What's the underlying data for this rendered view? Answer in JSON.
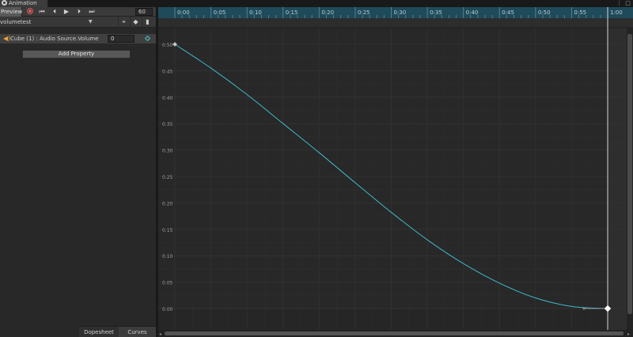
{
  "window": {
    "tab_title": "Animation"
  },
  "toolbar": {
    "preview_label": "Preview",
    "frame_value": "60",
    "buttons": [
      "first-key",
      "prev-key",
      "play",
      "next-key",
      "last-key"
    ]
  },
  "clip": {
    "name": "volumetest"
  },
  "property": {
    "label": "Cube (1) : Audio Source.Volume",
    "value": "0"
  },
  "add_property_label": "Add Property",
  "bottom_tabs": {
    "dopesheet": "Dopesheet",
    "curves": "Curves"
  },
  "chart_data": {
    "type": "line",
    "x_ticks": [
      "0:00",
      "0:05",
      "0:10",
      "0:15",
      "0:20",
      "0:25",
      "0:30",
      "0:35",
      "0:40",
      "0:45",
      "0:50",
      "0:55",
      "1:00"
    ],
    "y_ticks": [
      "0.50",
      "0.45",
      "0.40",
      "0.35",
      "0.30",
      "0.25",
      "0.20",
      "0.15",
      "0.10",
      "0.05",
      "0.00"
    ],
    "y_tick_values": [
      0.5,
      0.45,
      0.4,
      0.35,
      0.3,
      0.25,
      0.2,
      0.15,
      0.1,
      0.05,
      0.0
    ],
    "xlim": [
      0,
      60
    ],
    "ylim": [
      0,
      0.5
    ],
    "series": [
      {
        "x": [
          0,
          5,
          10,
          15,
          20,
          25,
          30,
          35,
          40,
          45,
          50,
          55,
          60
        ],
        "y": [
          0.5,
          0.455,
          0.405,
          0.35,
          0.295,
          0.238,
          0.182,
          0.13,
          0.085,
          0.048,
          0.02,
          0.004,
          0.0
        ]
      }
    ],
    "colors": {
      "curve": "#3fb7c8",
      "playhead": "#d8d8d8",
      "ruler": "#1f4a5a"
    }
  }
}
